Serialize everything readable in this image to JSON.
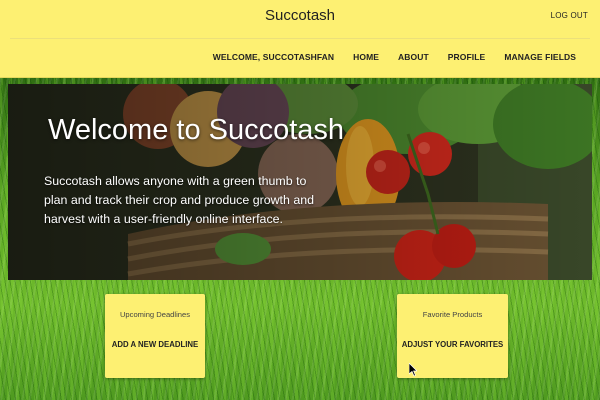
{
  "header": {
    "brand": "Succotash",
    "logout_label": "LOG OUT",
    "nav": {
      "welcome": "WELCOME, SUCCOTASHFAN",
      "home": "HOME",
      "about": "ABOUT",
      "profile": "PROFILE",
      "manage_fields": "MANAGE FIELDS"
    },
    "color": "#fdf072"
  },
  "hero": {
    "title": "Welcome to Succotash",
    "text": "Succotash allows anyone with a green thumb to plan and track their crop and produce growth and harvest with a user-friendly online interface."
  },
  "cards": {
    "deadlines": {
      "title": "Upcoming Deadlines",
      "action": "ADD A NEW DEADLINE"
    },
    "favorites": {
      "title": "Favorite Products",
      "action": "ADJUST YOUR FAVORITES"
    }
  },
  "icons": {
    "cursor": "mouse-pointer-icon"
  }
}
